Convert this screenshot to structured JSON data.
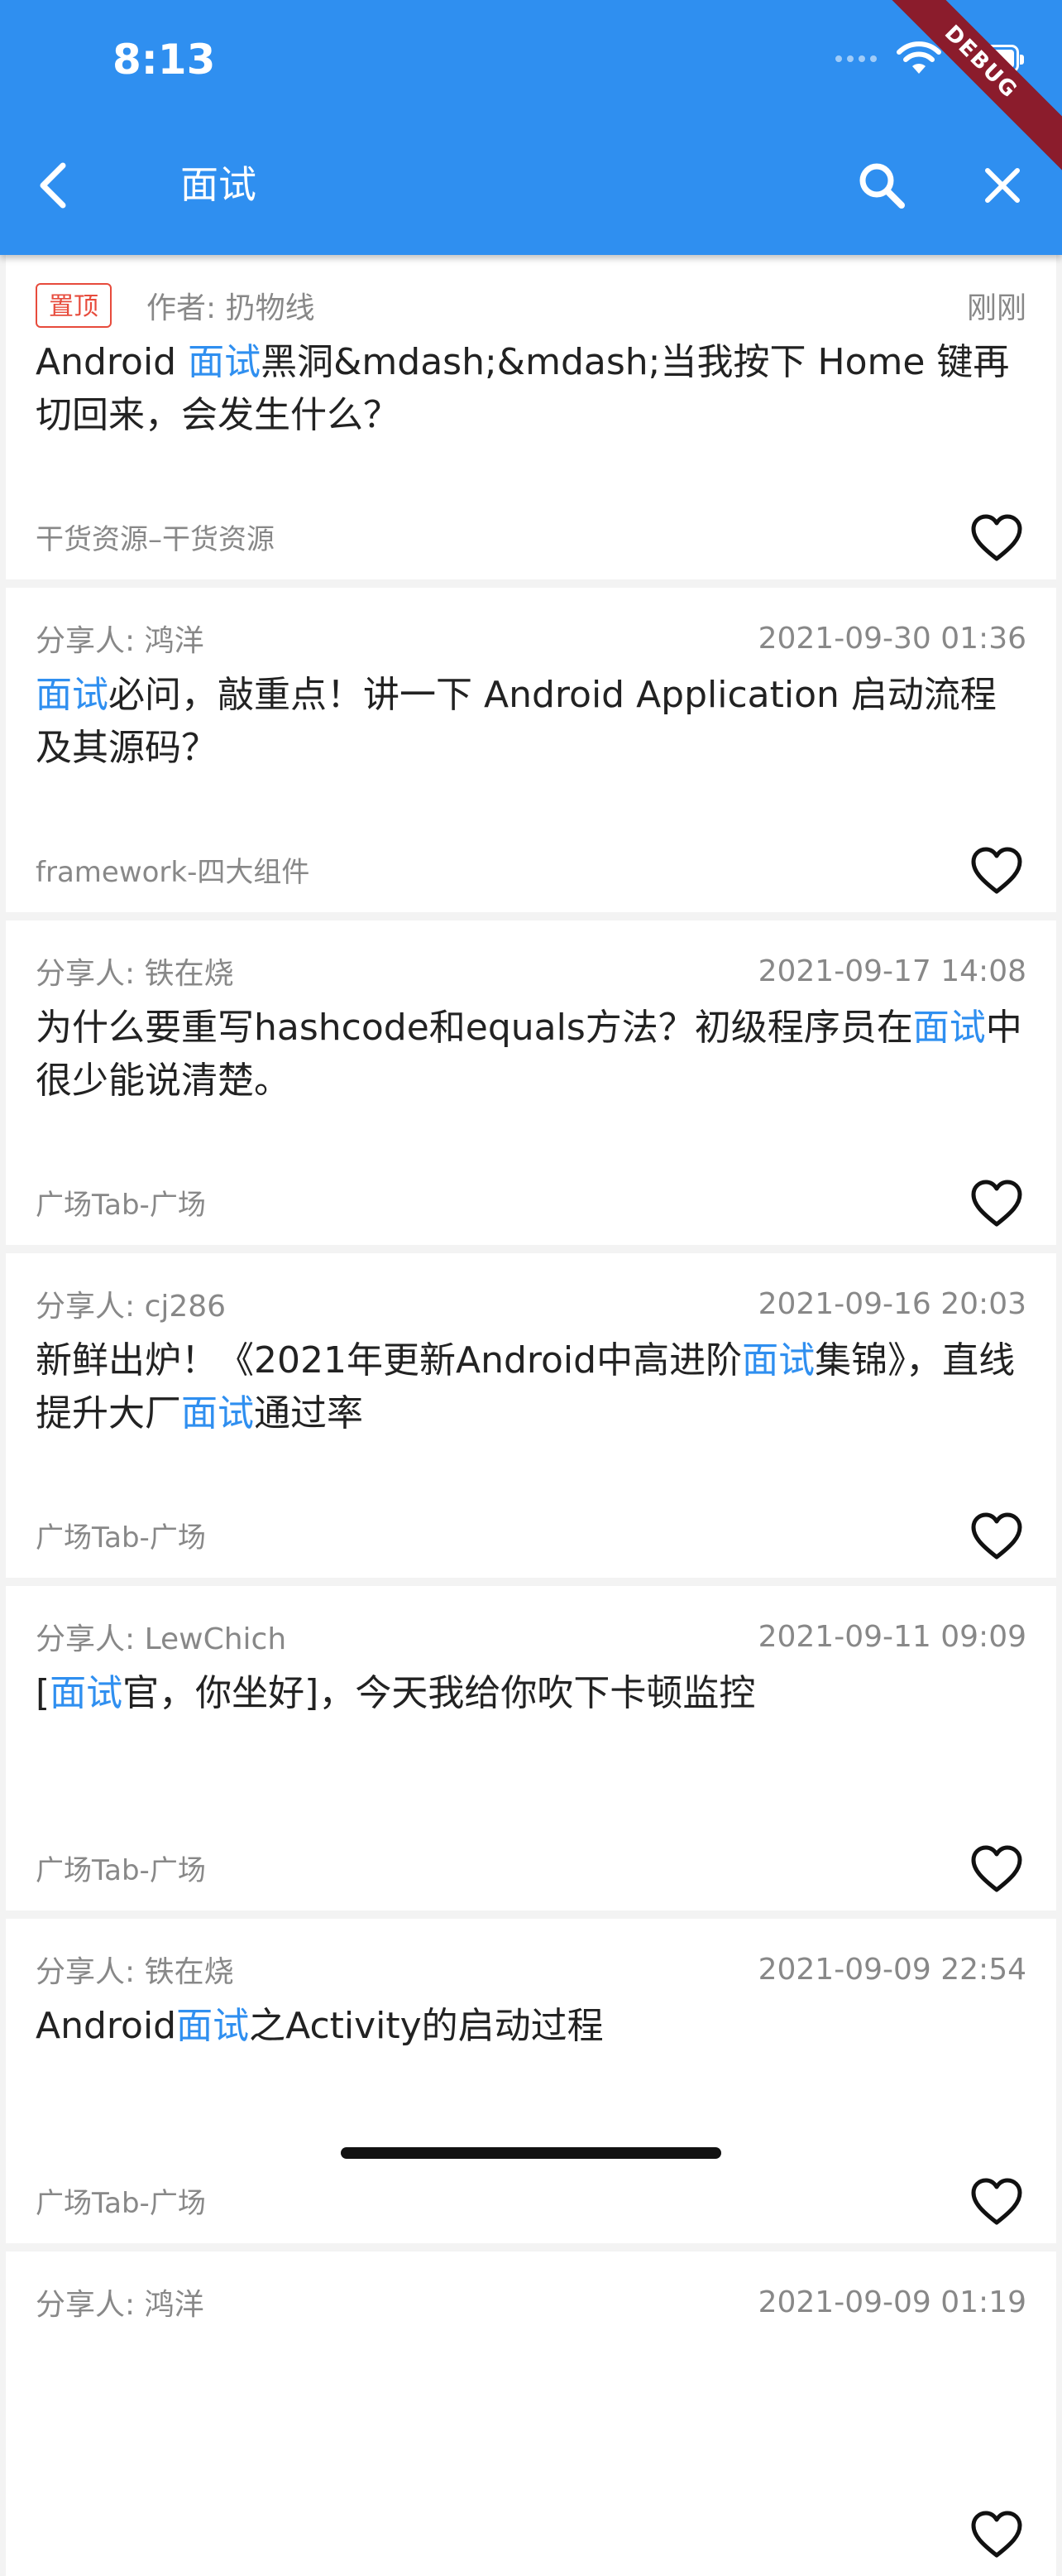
{
  "status_bar": {
    "time": "8:13"
  },
  "debug_banner": "DEBUG",
  "toolbar": {
    "title": "面试"
  },
  "articles": [
    {
      "pinned": true,
      "pin_label": "置顶",
      "author": "作者: 扔物线",
      "date": "刚刚",
      "title_parts": [
        {
          "text": "Android ",
          "hl": false
        },
        {
          "text": "面试",
          "hl": true
        },
        {
          "text": "黑洞&mdash;&mdash;当我按下 Home 键再切回来，会发生什么？",
          "hl": false
        }
      ],
      "category": "干货资源–干货资源"
    },
    {
      "pinned": false,
      "author": "分享人: 鸿洋",
      "date": "2021-09-30 01:36",
      "title_parts": [
        {
          "text": "面试",
          "hl": true
        },
        {
          "text": "必问，敲重点！讲一下 Android Application 启动流程及其源码？",
          "hl": false
        }
      ],
      "category": "framework-四大组件"
    },
    {
      "pinned": false,
      "author": "分享人: 铁在烧",
      "date": "2021-09-17 14:08",
      "title_parts": [
        {
          "text": "为什么要重写hashcode和equals方法？初级程序员在",
          "hl": false
        },
        {
          "text": "面试",
          "hl": true
        },
        {
          "text": "中很少能说清楚。",
          "hl": false
        }
      ],
      "category": "广场Tab-广场"
    },
    {
      "pinned": false,
      "author": "分享人: cj286",
      "date": "2021-09-16 20:03",
      "title_parts": [
        {
          "text": "新鲜出炉！《2021年更新Android中高进阶",
          "hl": false
        },
        {
          "text": "面试",
          "hl": true
        },
        {
          "text": "集锦》，直线提升大厂",
          "hl": false
        },
        {
          "text": "面试",
          "hl": true
        },
        {
          "text": "通过率",
          "hl": false
        }
      ],
      "category": "广场Tab-广场"
    },
    {
      "pinned": false,
      "author": "分享人: LewChich",
      "date": "2021-09-11 09:09",
      "title_parts": [
        {
          "text": "[",
          "hl": false
        },
        {
          "text": "面试",
          "hl": true
        },
        {
          "text": "官，你坐好]，今天我给你吹下卡顿监控",
          "hl": false
        }
      ],
      "category": "广场Tab-广场"
    },
    {
      "pinned": false,
      "author": "分享人: 铁在烧",
      "date": "2021-09-09 22:54",
      "title_parts": [
        {
          "text": "Android",
          "hl": false
        },
        {
          "text": "面试",
          "hl": true
        },
        {
          "text": "之Activity的启动过程",
          "hl": false
        }
      ],
      "category": "广场Tab-广场"
    },
    {
      "pinned": false,
      "author": "分享人: 鸿洋",
      "date": "2021-09-09 01:19",
      "title_parts": [],
      "category": ""
    }
  ]
}
